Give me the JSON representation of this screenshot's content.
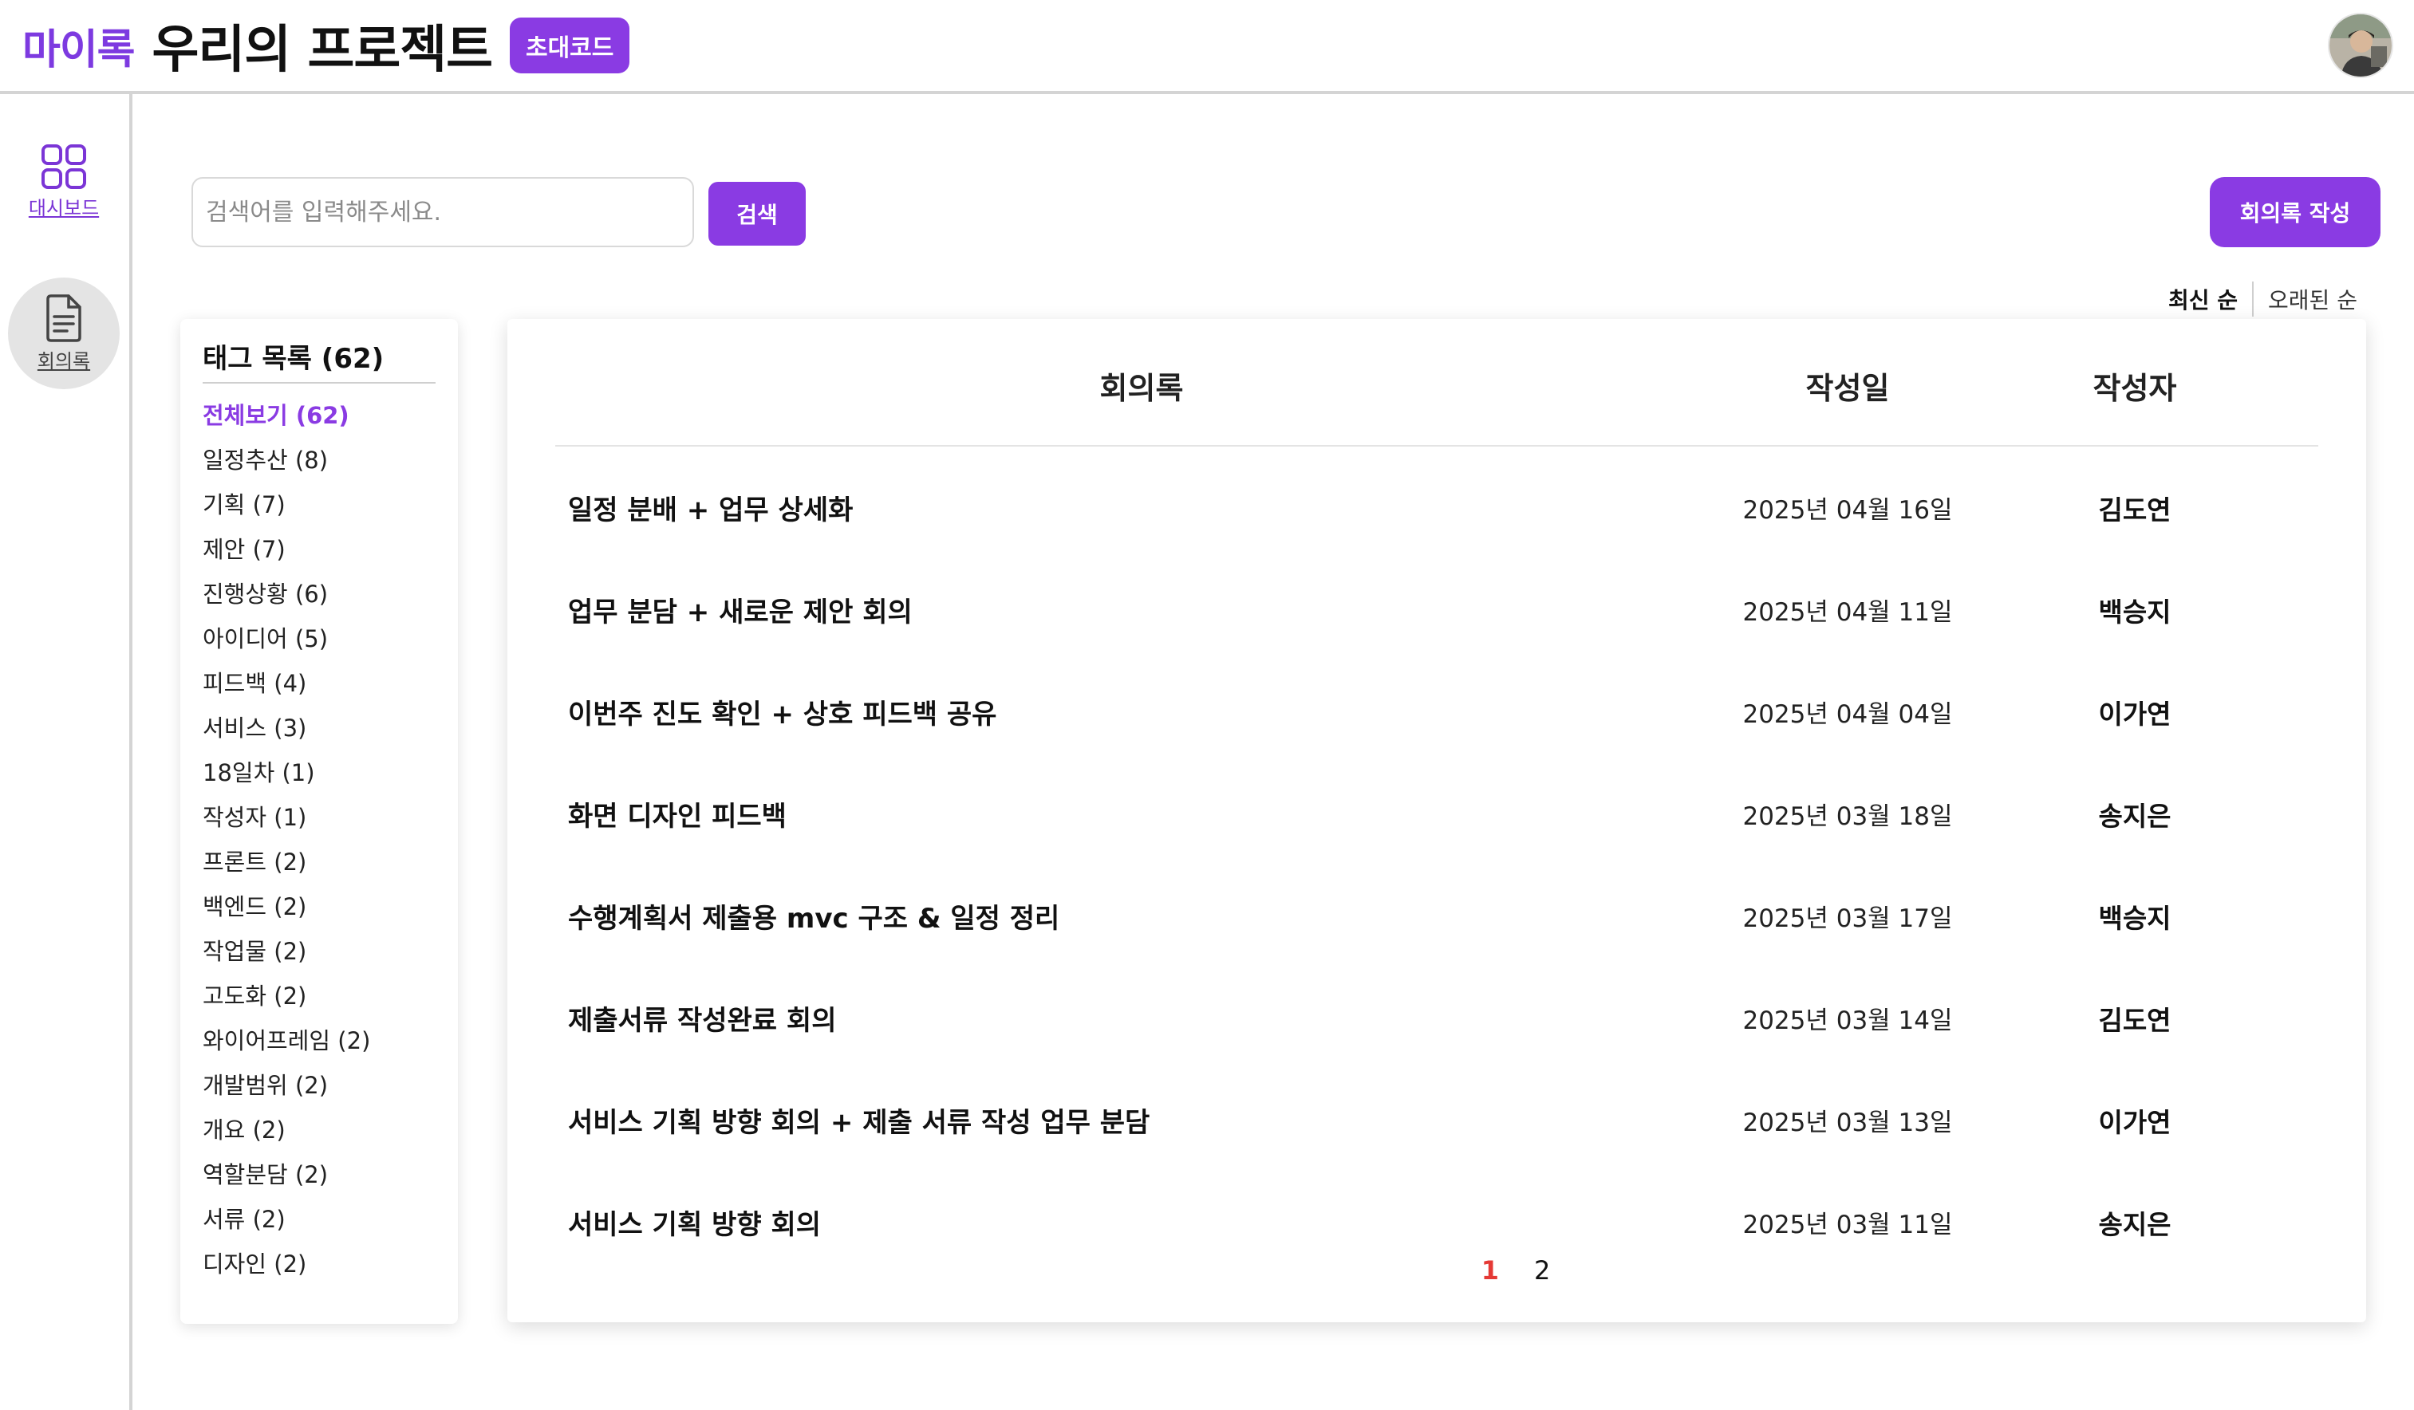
{
  "header": {
    "logo": "마이록",
    "project_title": "우리의 프로젝트",
    "invite_button": "초대코드"
  },
  "rail": {
    "items": [
      {
        "label": "대시보드",
        "icon": "grid-icon"
      },
      {
        "label": "회의록",
        "icon": "document-icon"
      }
    ]
  },
  "search": {
    "placeholder": "검색어를 입력해주세요.",
    "button_label": "검색"
  },
  "write_button": "회의록 작성",
  "sort": {
    "newest": "최신 순",
    "oldest": "오래된 순"
  },
  "tags": {
    "title": "태그 목록 (62)",
    "items": [
      "전체보기 (62)",
      "일정추산 (8)",
      "기획 (7)",
      "제안 (7)",
      "진행상황 (6)",
      "아이디어 (5)",
      "피드백 (4)",
      "서비스 (3)",
      "18일차 (1)",
      "작성자 (1)",
      "프론트 (2)",
      "백엔드 (2)",
      "작업물 (2)",
      "고도화 (2)",
      "와이어프레임 (2)",
      "개발범위 (2)",
      "개요 (2)",
      "역할분담 (2)",
      "서류 (2)",
      "디자인 (2)"
    ]
  },
  "table": {
    "headers": {
      "title": "회의록",
      "date": "작성일",
      "author": "작성자"
    },
    "rows": [
      {
        "title": "일정 분배 + 업무 상세화",
        "date": "2025년 04월 16일",
        "author": "김도연"
      },
      {
        "title": "업무 분담 + 새로운 제안 회의",
        "date": "2025년 04월 11일",
        "author": "백승지"
      },
      {
        "title": "이번주 진도 확인 + 상호 피드백 공유",
        "date": "2025년 04월 04일",
        "author": "이가연"
      },
      {
        "title": "화면 디자인 피드백",
        "date": "2025년 03월 18일",
        "author": "송지은"
      },
      {
        "title": "수행계획서 제출용 mvc 구조 & 일정 정리",
        "date": "2025년 03월 17일",
        "author": "백승지"
      },
      {
        "title": "제출서류 작성완료 회의",
        "date": "2025년 03월 14일",
        "author": "김도연"
      },
      {
        "title": "서비스 기획 방향 회의 + 제출 서류 작성 업무 분담",
        "date": "2025년 03월 13일",
        "author": "이가연"
      },
      {
        "title": "서비스 기획 방향 회의",
        "date": "2025년 03월 11일",
        "author": "송지은"
      }
    ]
  },
  "pagination": {
    "pages": [
      "1",
      "2"
    ],
    "current": "1"
  },
  "colors": {
    "accent": "#8a3be3",
    "current_page": "#e53935"
  }
}
